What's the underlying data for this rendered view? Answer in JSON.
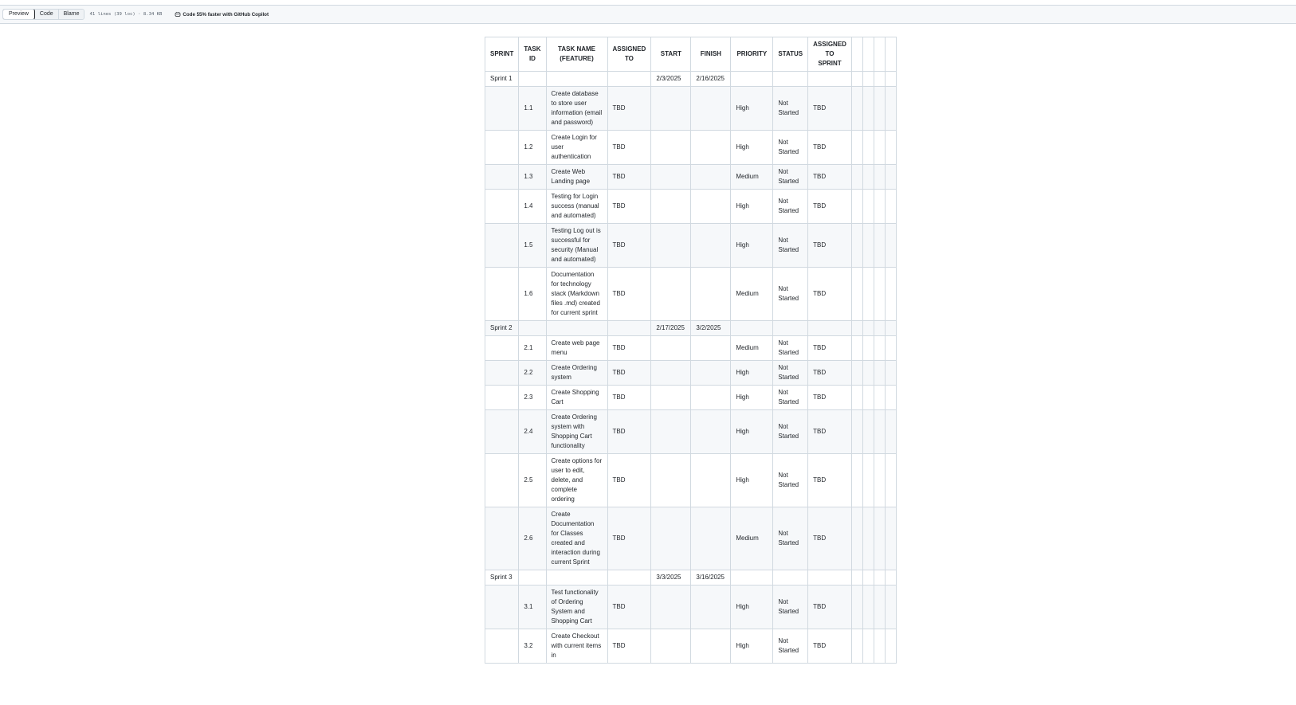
{
  "toolbar": {
    "tabs": [
      {
        "label": "Preview",
        "active": true
      },
      {
        "label": "Code",
        "active": false
      },
      {
        "label": "Blame",
        "active": false
      }
    ],
    "file_info": "41 lines (39 loc) · 8.34 KB",
    "copilot_text": "Code 55% faster with GitHub Copilot"
  },
  "table": {
    "headers": [
      "SPRINT",
      "TASK ID",
      "TASK NAME (FEATURE)",
      "ASSIGNED TO",
      "START",
      "FINISH",
      "PRIORITY",
      "STATUS",
      "ASSIGNED TO SPRINT",
      "",
      "",
      "",
      ""
    ],
    "rows": [
      [
        "Sprint 1",
        "",
        "",
        "",
        "2/3/2025",
        "2/16/2025",
        "",
        "",
        "",
        "",
        "",
        "",
        ""
      ],
      [
        "",
        "1.1",
        "Create database to store user information (email and password)",
        "TBD",
        "",
        "",
        "High",
        "Not Started",
        "TBD",
        "",
        "",
        "",
        ""
      ],
      [
        "",
        "1.2",
        "Create Login for user authentication",
        "TBD",
        "",
        "",
        "High",
        "Not Started",
        "TBD",
        "",
        "",
        "",
        ""
      ],
      [
        "",
        "1.3",
        "Create Web Landing page",
        "TBD",
        "",
        "",
        "Medium",
        "Not Started",
        "TBD",
        "",
        "",
        "",
        ""
      ],
      [
        "",
        "1.4",
        "Testing for Login success (manual and automated)",
        "TBD",
        "",
        "",
        "High",
        "Not Started",
        "TBD",
        "",
        "",
        "",
        ""
      ],
      [
        "",
        "1.5",
        "Testing Log out is successful for security (Manual and automated)",
        "TBD",
        "",
        "",
        "High",
        "Not Started",
        "TBD",
        "",
        "",
        "",
        ""
      ],
      [
        "",
        "1.6",
        "Documentation for technology stack (Markdown files .md) created for current sprint",
        "TBD",
        "",
        "",
        "Medium",
        "Not Started",
        "TBD",
        "",
        "",
        "",
        ""
      ],
      [
        "Sprint 2",
        "",
        "",
        "",
        "2/17/2025",
        "3/2/2025",
        "",
        "",
        "",
        "",
        "",
        "",
        ""
      ],
      [
        "",
        "2.1",
        "Create web page menu",
        "TBD",
        "",
        "",
        "Medium",
        "Not Started",
        "TBD",
        "",
        "",
        "",
        ""
      ],
      [
        "",
        "2.2",
        "Create Ordering system",
        "TBD",
        "",
        "",
        "High",
        "Not Started",
        "TBD",
        "",
        "",
        "",
        ""
      ],
      [
        "",
        "2.3",
        "Create Shopping Cart",
        "TBD",
        "",
        "",
        "High",
        "Not Started",
        "TBD",
        "",
        "",
        "",
        ""
      ],
      [
        "",
        "2.4",
        "Create Ordering system with Shopping Cart functionality",
        "TBD",
        "",
        "",
        "High",
        "Not Started",
        "TBD",
        "",
        "",
        "",
        ""
      ],
      [
        "",
        "2.5",
        "Create options for user to edit, delete, and complete ordering",
        "TBD",
        "",
        "",
        "High",
        "Not Started",
        "TBD",
        "",
        "",
        "",
        ""
      ],
      [
        "",
        "2.6",
        "Create Documentation for Classes created and interaction during current Sprint",
        "TBD",
        "",
        "",
        "Medium",
        "Not Started",
        "TBD",
        "",
        "",
        "",
        ""
      ],
      [
        "Sprint 3",
        "",
        "",
        "",
        "3/3/2025",
        "3/16/2025",
        "",
        "",
        "",
        "",
        "",
        "",
        ""
      ],
      [
        "",
        "3.1",
        "Test functionality of Ordering System and Shopping Cart",
        "TBD",
        "",
        "",
        "High",
        "Not Started",
        "TBD",
        "",
        "",
        "",
        ""
      ],
      [
        "",
        "3.2",
        "Create Checkout with current items in",
        "TBD",
        "",
        "",
        "High",
        "Not Started",
        "TBD",
        "",
        "",
        "",
        ""
      ]
    ]
  }
}
